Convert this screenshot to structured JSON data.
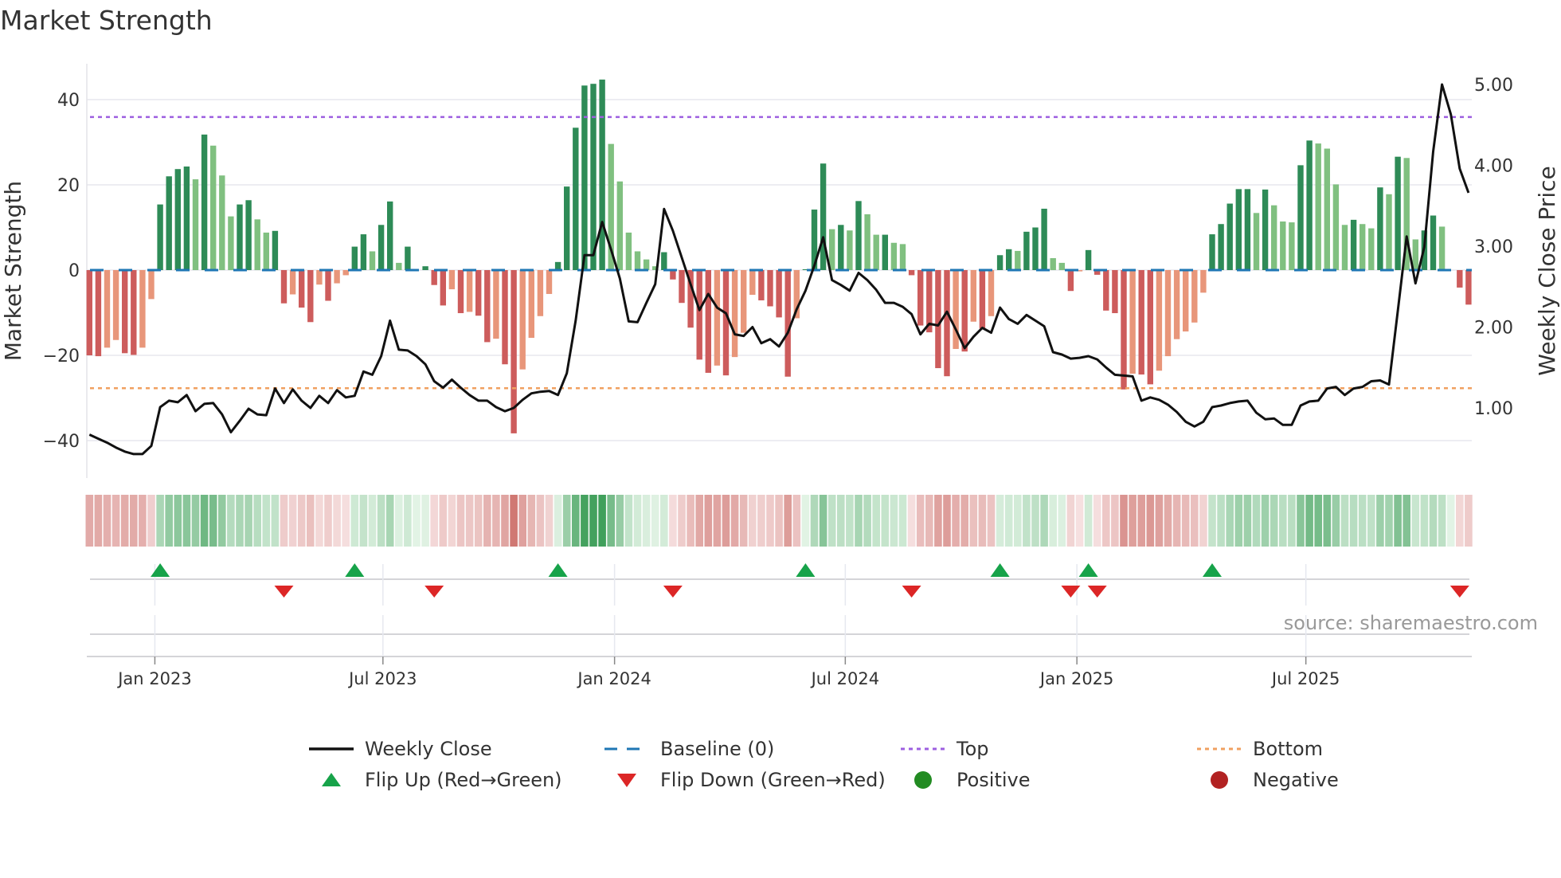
{
  "title": "Market Strength",
  "source": "source: sharemaestro.com",
  "colors": {
    "bar_pos_dark": "#2e8b57",
    "bar_pos_light": "#80c080",
    "bar_neg_dark": "#cd5c5c",
    "bar_neg_light": "#e8967a",
    "close": "#111111",
    "baseline": "#1f77b4",
    "top": "#9d5fe0",
    "bottom": "#f0a060",
    "flip_up": "#17a34a",
    "flip_down": "#dc2626",
    "positive": "#228b22",
    "negative": "#b22222"
  },
  "legend": [
    {
      "label": "Weekly Close",
      "icon": "solid-line"
    },
    {
      "label": "Baseline (0)",
      "icon": "dashed-line"
    },
    {
      "label": "Top",
      "icon": "dotted-line-purple"
    },
    {
      "label": "Bottom",
      "icon": "dotted-line-orange"
    },
    {
      "label": "Flip Up (Red→Green)",
      "icon": "triangle-up"
    },
    {
      "label": "Flip Down (Green→Red)",
      "icon": "triangle-down"
    },
    {
      "label": "Positive",
      "icon": "circle-green"
    },
    {
      "label": "Negative",
      "icon": "circle-red"
    }
  ],
  "chart_data": {
    "type": "bar",
    "title": "Market Strength",
    "ylabel": "Market Strength",
    "y2label": "Weekly Close Price",
    "ylim": [
      -48,
      48
    ],
    "y2lim": [
      0.33,
      5.2
    ],
    "yticks": [
      "40",
      "20",
      "0",
      "−20",
      "−40"
    ],
    "ytick_values": [
      40,
      20,
      0,
      -20,
      -40
    ],
    "y2ticks": [
      "5.00",
      "4.00",
      "3.00",
      "2.00",
      "1.00"
    ],
    "y2tick_values": [
      5,
      4,
      3,
      2,
      1
    ],
    "xticks": [
      {
        "label": "Jan 2023",
        "week": 8.4
      },
      {
        "label": "Jul 2023",
        "week": 34.2
      },
      {
        "label": "Jan 2024",
        "week": 60.4
      },
      {
        "label": "Jul 2024",
        "week": 86.5
      },
      {
        "label": "Jan 2025",
        "week": 112.7
      },
      {
        "label": "Jul 2025",
        "week": 138.6
      }
    ],
    "top_level": 35.9,
    "bottom_level": -27.7,
    "baseline": 0,
    "grid": true,
    "legend_position": "bottom",
    "strength": [
      -20,
      -20.2,
      -18.2,
      -16.4,
      -19.5,
      -19.9,
      -18.2,
      -6.8,
      15.4,
      22,
      23.7,
      24.3,
      21.3,
      31.8,
      29.2,
      22.2,
      12.6,
      15.4,
      16.4,
      11.9,
      8.8,
      9.2,
      -7.8,
      -5.7,
      -8.8,
      -12.2,
      -3.4,
      -7.2,
      -3.1,
      -1.2,
      5.5,
      8.4,
      4.4,
      10.6,
      16.1,
      1.7,
      5.5,
      0,
      0.9,
      -3.5,
      -8.3,
      -4.5,
      -10.1,
      -9.8,
      -10.7,
      -16.9,
      -16.1,
      -22.1,
      -38.3,
      -23.3,
      -15.9,
      -10.8,
      -5.6,
      1.9,
      19.6,
      33.4,
      43.3,
      43.7,
      44.7,
      29.6,
      20.8,
      8.8,
      4.4,
      2.5,
      0.9,
      4.2,
      -2.2,
      -7.7,
      -13.5,
      -21,
      -24.1,
      -22.4,
      -24.7,
      -20.4,
      -14.7,
      -5.8,
      -7.1,
      -8.5,
      -11.1,
      -25,
      -11.3,
      0.2,
      14.2,
      25,
      9.6,
      10.6,
      9.3,
      16.2,
      13.1,
      8.3,
      8.3,
      6.4,
      6.1,
      -1.2,
      -13,
      -14.6,
      -23,
      -24.9,
      -18.5,
      -19.1,
      -12.1,
      -13.7,
      -10.8,
      3.5,
      4.9,
      4.5,
      9,
      10,
      14.4,
      2.8,
      1.7,
      -4.9,
      -0.3,
      4.7,
      -1.1,
      -9.5,
      -10.1,
      -28,
      -24.3,
      -24.5,
      -26.8,
      -23.6,
      -20.2,
      -16.2,
      -14.4,
      -12.3,
      -5.3,
      8.4,
      10.8,
      15.6,
      19,
      19,
      13.4,
      18.9,
      15.2,
      11.4,
      11.2,
      24.6,
      30.4,
      29.7,
      28.5,
      20.1,
      10.6,
      11.8,
      10.8,
      9.8,
      19.4,
      17.8,
      26.6,
      26.3,
      7.2,
      9.3,
      12.8,
      10.2,
      0,
      -4.1,
      -8.1
    ],
    "shade": "DDLLDDLLDDDDLDLLLDDLLDDLDDLDLLDDLDDLDDDDDLDLDDLDDLLLLDDDDDDLLLLLLDDDDDDLDLLLDDDDLDDDLDLDLLDLLDDDDDLDLDLDDLDDDLLDLDDDDDLDDLLLLLLDDDDDLDLLLDDLLLLDLLDLDLLDDLDDD",
    "weekly_close": [
      0.67,
      0.62,
      0.57,
      0.51,
      0.46,
      0.43,
      0.43,
      0.53,
      1.01,
      1.09,
      1.07,
      1.16,
      0.96,
      1.05,
      1.06,
      0.92,
      0.7,
      0.84,
      0.99,
      0.92,
      0.91,
      1.24,
      1.06,
      1.23,
      1.09,
      1.0,
      1.15,
      1.06,
      1.22,
      1.13,
      1.15,
      1.45,
      1.41,
      1.64,
      2.08,
      1.72,
      1.71,
      1.64,
      1.54,
      1.33,
      1.25,
      1.35,
      1.25,
      1.16,
      1.09,
      1.09,
      1.01,
      0.96,
      1.0,
      1.1,
      1.18,
      1.2,
      1.21,
      1.16,
      1.43,
      2.08,
      2.89,
      2.89,
      3.3,
      2.96,
      2.6,
      2.07,
      2.06,
      2.3,
      2.53,
      3.46,
      3.19,
      2.86,
      2.53,
      2.21,
      2.41,
      2.24,
      2.17,
      1.91,
      1.89,
      2.0,
      1.8,
      1.85,
      1.76,
      1.93,
      2.22,
      2.45,
      2.76,
      3.11,
      2.58,
      2.52,
      2.45,
      2.67,
      2.58,
      2.46,
      2.3,
      2.3,
      2.25,
      2.16,
      1.91,
      2.04,
      2.02,
      2.19,
      1.97,
      1.74,
      1.88,
      1.99,
      1.93,
      2.24,
      2.1,
      2.04,
      2.15,
      2.08,
      2.01,
      1.69,
      1.66,
      1.61,
      1.62,
      1.64,
      1.6,
      1.5,
      1.41,
      1.4,
      1.39,
      1.09,
      1.13,
      1.1,
      1.04,
      0.95,
      0.83,
      0.77,
      0.83,
      1.01,
      1.03,
      1.06,
      1.08,
      1.09,
      0.94,
      0.86,
      0.87,
      0.79,
      0.79,
      1.03,
      1.08,
      1.09,
      1.24,
      1.26,
      1.16,
      1.24,
      1.26,
      1.33,
      1.34,
      1.29,
      2.2,
      3.12,
      2.54,
      2.99,
      4.17,
      5.0,
      4.63,
      3.96,
      3.66
    ],
    "flip_up_weeks": [
      9,
      31,
      54,
      82,
      104,
      114,
      128
    ],
    "flip_down_weeks": [
      23,
      40,
      67,
      94,
      112,
      115,
      156
    ]
  }
}
